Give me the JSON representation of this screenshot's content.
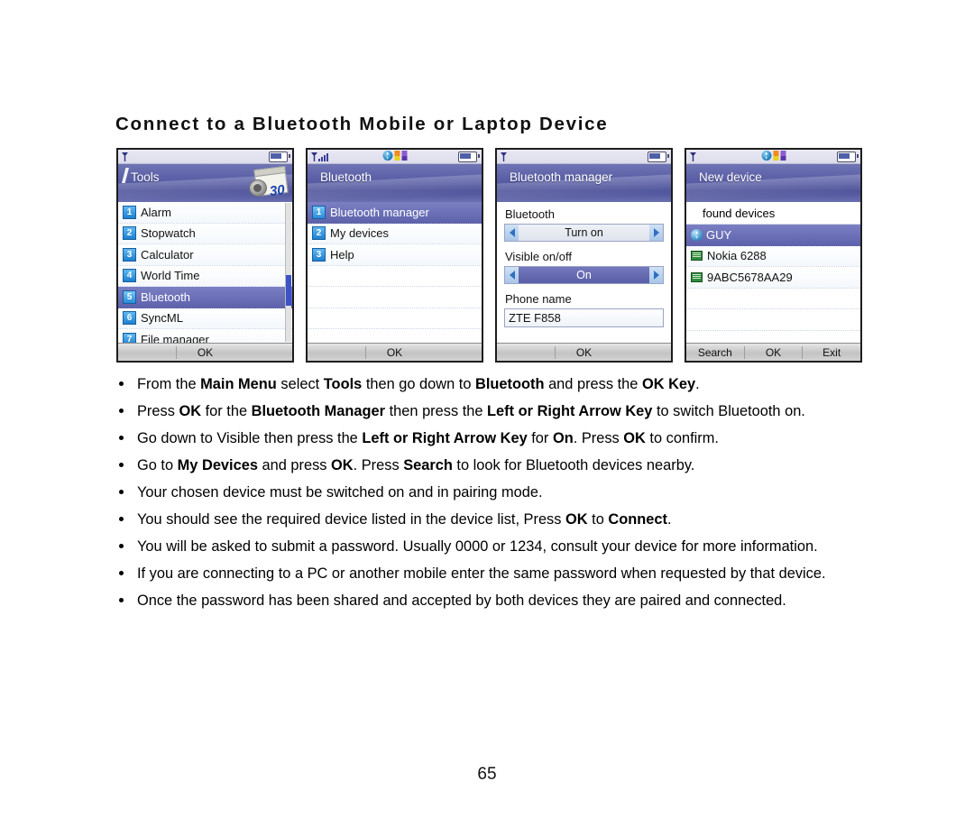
{
  "document": {
    "title": "Connect to a Bluetooth Mobile or Laptop Device",
    "page_number": "65"
  },
  "screens": [
    {
      "name": "tools-menu",
      "banner_title": "Tools",
      "banner_icon": "calendar-30-icon",
      "calendar_day": "30",
      "softkeys": [
        "",
        "OK",
        ""
      ],
      "items": [
        {
          "num": "1",
          "label": "Alarm",
          "selected": false
        },
        {
          "num": "2",
          "label": "Stopwatch",
          "selected": false
        },
        {
          "num": "3",
          "label": "Calculator",
          "selected": false
        },
        {
          "num": "4",
          "label": "World Time",
          "selected": false
        },
        {
          "num": "5",
          "label": "Bluetooth",
          "selected": true
        },
        {
          "num": "6",
          "label": "SyncML",
          "selected": false
        },
        {
          "num": "7",
          "label": "File manager",
          "selected": false
        }
      ]
    },
    {
      "name": "bluetooth-menu",
      "banner_title": "Bluetooth",
      "softkeys": [
        "",
        "OK",
        ""
      ],
      "items": [
        {
          "num": "1",
          "label": "Bluetooth manager",
          "selected": true
        },
        {
          "num": "2",
          "label": "My devices",
          "selected": false
        },
        {
          "num": "3",
          "label": "Help",
          "selected": false
        }
      ]
    },
    {
      "name": "bluetooth-manager",
      "banner_title": "Bluetooth manager",
      "softkeys": [
        "",
        "OK",
        ""
      ],
      "fields": [
        {
          "label": "Bluetooth",
          "control": "spinner",
          "value": "Turn on",
          "highlighted": false
        },
        {
          "label": "Visible on/off",
          "control": "spinner",
          "value": "On",
          "highlighted": true
        },
        {
          "label": "Phone name",
          "control": "textbox",
          "value": "ZTE F858"
        }
      ]
    },
    {
      "name": "new-device",
      "banner_title": "New device",
      "subheader": "found devices",
      "softkeys": [
        "Search",
        "OK",
        "Exit"
      ],
      "devices": [
        {
          "label": "GUY",
          "icon": "bluetooth-icon",
          "selected": true
        },
        {
          "label": "Nokia 6288",
          "icon": "device-icon",
          "selected": false
        },
        {
          "label": "9ABC5678AA29",
          "icon": "device-icon",
          "selected": false
        }
      ]
    }
  ],
  "instructions": [
    [
      {
        "t": "From the "
      },
      {
        "t": "Main Menu",
        "b": true
      },
      {
        "t": " select "
      },
      {
        "t": "Tools",
        "b": true
      },
      {
        "t": " then go down to "
      },
      {
        "t": "Bluetooth",
        "b": true
      },
      {
        "t": " and press the "
      },
      {
        "t": "OK Key",
        "b": true
      },
      {
        "t": "."
      }
    ],
    [
      {
        "t": "Press "
      },
      {
        "t": "OK",
        "b": true
      },
      {
        "t": " for the "
      },
      {
        "t": "Bluetooth Manager",
        "b": true
      },
      {
        "t": " then press the "
      },
      {
        "t": "Left or Right Arrow Key",
        "b": true
      },
      {
        "t": " to switch Bluetooth on."
      }
    ],
    [
      {
        "t": "Go down to Visible then press the "
      },
      {
        "t": "Left or Right Arrow Key",
        "b": true
      },
      {
        "t": " for "
      },
      {
        "t": "On",
        "b": true
      },
      {
        "t": ". Press "
      },
      {
        "t": "OK",
        "b": true
      },
      {
        "t": " to confirm."
      }
    ],
    [
      {
        "t": "Go to "
      },
      {
        "t": "My Devices",
        "b": true
      },
      {
        "t": " and press "
      },
      {
        "t": "OK",
        "b": true
      },
      {
        "t": ". Press "
      },
      {
        "t": "Search",
        "b": true
      },
      {
        "t": " to look for Bluetooth devices nearby."
      }
    ],
    [
      {
        "t": "Your chosen device must be switched on and in pairing mode."
      }
    ],
    [
      {
        "t": "You should see the required device listed in the device list, Press "
      },
      {
        "t": "OK",
        "b": true
      },
      {
        "t": " to "
      },
      {
        "t": "Connect",
        "b": true
      },
      {
        "t": "."
      }
    ],
    [
      {
        "t": "You will be asked to submit a password. Usually 0000 or 1234, consult your device for more information."
      }
    ],
    [
      {
        "t": "If you are connecting to a PC or another mobile enter the same password when requested by that device."
      }
    ],
    [
      {
        "t": "Once the password has been shared and accepted by both devices they are paired and connected."
      }
    ]
  ]
}
